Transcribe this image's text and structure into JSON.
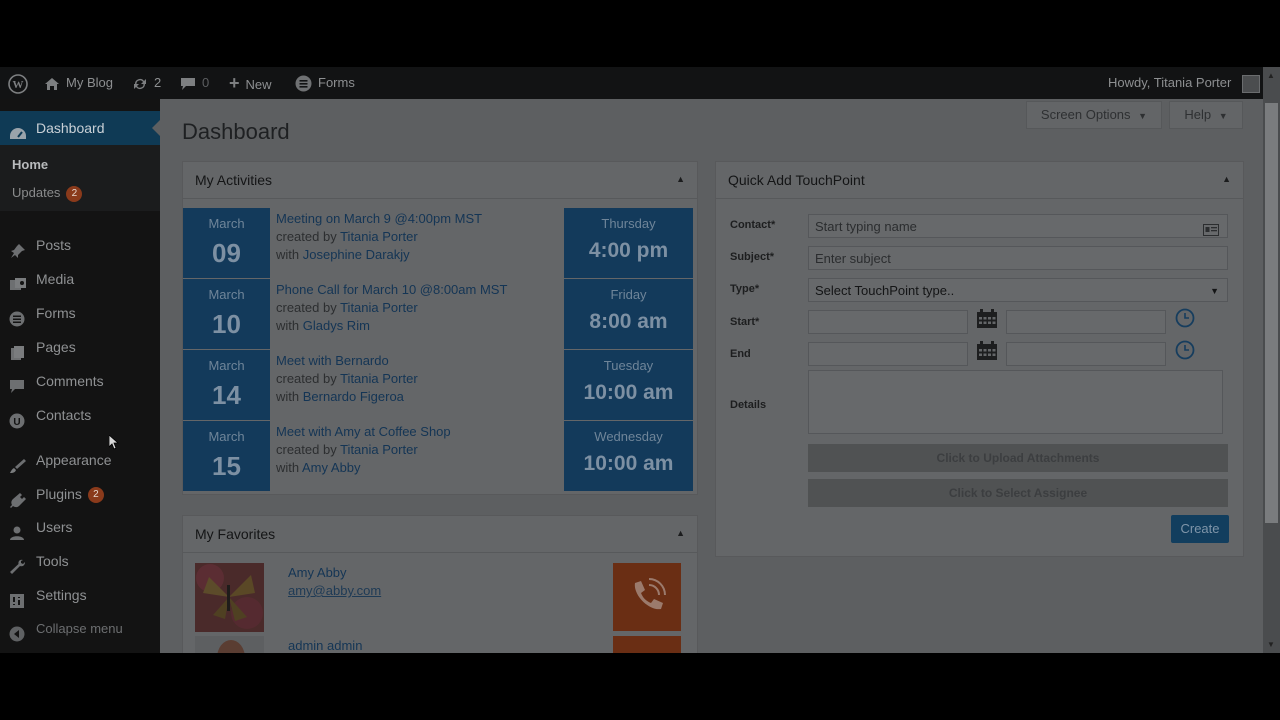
{
  "adminbar": {
    "site_name": "My Blog",
    "updates_count": "2",
    "comments_count": "0",
    "new_label": "New",
    "forms_label": "Forms",
    "howdy": "Howdy, Titania Porter"
  },
  "sidebar": {
    "dashboard": "Dashboard",
    "home": "Home",
    "updates": "Updates",
    "updates_badge": "2",
    "items": [
      {
        "label": "Posts",
        "icon": "pin-icon"
      },
      {
        "label": "Media",
        "icon": "media-icon"
      },
      {
        "label": "Forms",
        "icon": "forms-icon"
      },
      {
        "label": "Pages",
        "icon": "pages-icon"
      },
      {
        "label": "Comments",
        "icon": "comments-icon"
      },
      {
        "label": "Contacts",
        "icon": "contacts-icon"
      },
      {
        "label": "Appearance",
        "icon": "brush-icon"
      },
      {
        "label": "Plugins",
        "icon": "plugin-icon"
      },
      {
        "label": "Users",
        "icon": "users-icon"
      },
      {
        "label": "Tools",
        "icon": "wrench-icon"
      },
      {
        "label": "Settings",
        "icon": "settings-icon"
      },
      {
        "label": "Collapse menu",
        "icon": "collapse-icon"
      }
    ],
    "plugins_badge": "2"
  },
  "header": {
    "title": "Dashboard",
    "screen_options": "Screen Options",
    "help": "Help"
  },
  "activities": {
    "title": "My Activities",
    "rows": [
      {
        "month": "March",
        "day": "09",
        "title": "Meeting on March 9 @4:00pm MST",
        "created_by_prefix": "created by ",
        "created_by": "Titania Porter",
        "with_prefix": "with ",
        "with": "Josephine Darakjy",
        "weekday": "Thursday",
        "time": "4:00 pm"
      },
      {
        "month": "March",
        "day": "10",
        "title": "Phone Call for March 10 @8:00am MST",
        "created_by_prefix": "created by ",
        "created_by": "Titania Porter",
        "with_prefix": "with ",
        "with": "Gladys Rim",
        "weekday": "Friday",
        "time": "8:00 am"
      },
      {
        "month": "March",
        "day": "14",
        "title": "Meet with Bernardo",
        "created_by_prefix": "created by ",
        "created_by": "Titania Porter",
        "with_prefix": "with ",
        "with": "Bernardo Figeroa",
        "weekday": "Tuesday",
        "time": "10:00 am"
      },
      {
        "month": "March",
        "day": "15",
        "title": "Meet with Amy at Coffee Shop",
        "created_by_prefix": "created by ",
        "created_by": "Titania Porter",
        "with_prefix": "with ",
        "with": "Amy Abby",
        "weekday": "Wednesday",
        "time": "10:00 am"
      }
    ]
  },
  "favorites": {
    "title": "My Favorites",
    "rows": [
      {
        "name": "Amy Abby",
        "email": "amy@abby.com"
      },
      {
        "name": "admin admin",
        "email": ""
      }
    ]
  },
  "quick_add": {
    "title": "Quick Add TouchPoint",
    "contact_label": "Contact*",
    "contact_placeholder": "Start typing name",
    "subject_label": "Subject*",
    "subject_placeholder": "Enter subject",
    "type_label": "Type*",
    "type_value": "Select TouchPoint type..",
    "start_label": "Start*",
    "end_label": "End",
    "details_label": "Details",
    "upload_button": "Click to Upload Attachments",
    "assignee_button": "Click to Select Assignee",
    "create_button": "Create"
  },
  "colors": {
    "accent": "#133a5b",
    "call_orange": "#6a2e14",
    "badge": "#8a3a1b"
  }
}
